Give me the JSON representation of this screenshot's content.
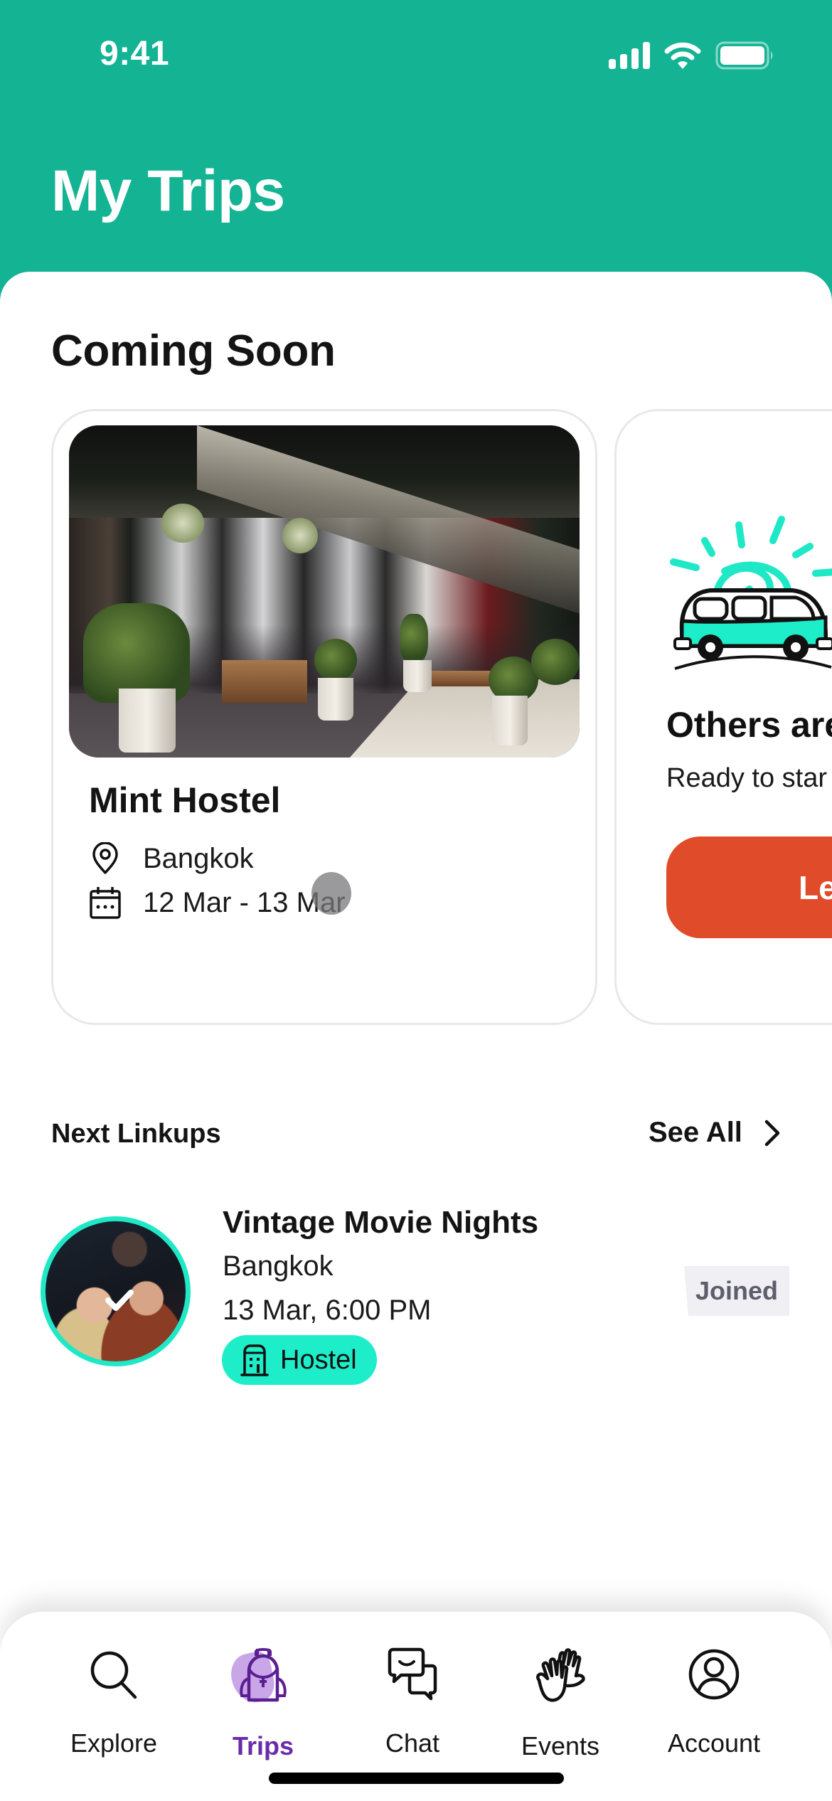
{
  "status_bar": {
    "time": "9:41",
    "icons": [
      "signal-icon",
      "wifi-icon",
      "battery-icon"
    ]
  },
  "header": {
    "title": "My Trips",
    "background_color": "#13B393"
  },
  "coming_soon": {
    "title": "Coming Soon",
    "trips": [
      {
        "name": "Mint Hostel",
        "image": "hostel-exterior-photo",
        "location_icon": "map-pin-icon",
        "location": "Bangkok",
        "date_icon": "calendar-icon",
        "dates": "12 Mar - 13 Mar"
      }
    ],
    "promo_card": {
      "illustration": "camper-van-sun-illustration",
      "title": "Others are",
      "subtitle": "Ready to star",
      "button_label": "Le",
      "button_color": "#E04B2A"
    }
  },
  "next_linkups": {
    "title": "Next Linkups",
    "see_all_label": "See All",
    "items": [
      {
        "title": "Vintage Movie Nights",
        "city": "Bangkok",
        "datetime": "13 Mar, 6:00 PM",
        "type_label": "Hostel",
        "type_icon": "building-icon",
        "status": "Joined",
        "joined": true
      }
    ]
  },
  "tab_bar": {
    "active": "Trips",
    "accent_color": "#6A2BA8",
    "tabs": [
      {
        "label": "Explore",
        "icon": "search-icon"
      },
      {
        "label": "Trips",
        "icon": "backpack-icon"
      },
      {
        "label": "Chat",
        "icon": "chat-bubbles-icon"
      },
      {
        "label": "Events",
        "icon": "high-five-icon"
      },
      {
        "label": "Account",
        "icon": "user-circle-icon"
      }
    ]
  },
  "colors": {
    "mint": "#1EEDC9",
    "joined_bg": "#EFEFF4",
    "joined_text": "#5D5D6C"
  }
}
